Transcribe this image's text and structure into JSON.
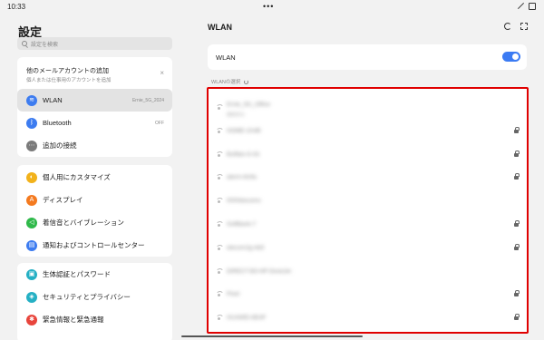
{
  "status": {
    "time": "10:33"
  },
  "sidebar": {
    "title": "設定",
    "search_placeholder": "設定を検索",
    "account": {
      "title": "他のメールアカウントの追加",
      "subtitle": "個人または仕事用のアカウントを追加",
      "close_icon": "close-icon"
    },
    "groups": [
      [
        {
          "label": "WLAN",
          "value": "Ernie_5G_2024",
          "icon": "wifi-icon",
          "color": "#3d7cf0",
          "selected": true
        },
        {
          "label": "Bluetooth",
          "value": "OFF",
          "icon": "bluetooth-icon",
          "color": "#3d7cf0"
        },
        {
          "label": "追加の接続",
          "value": "",
          "icon": "more-connections-icon",
          "color": "#7b7b7b"
        }
      ],
      [
        {
          "label": "個人用にカスタマイズ",
          "icon": "palette-icon",
          "color": "#f2b21b"
        },
        {
          "label": "ディスプレイ",
          "icon": "display-icon",
          "color": "#f47a1f"
        },
        {
          "label": "着信音とバイブレーション",
          "icon": "sound-icon",
          "color": "#2fb94a"
        },
        {
          "label": "通知およびコントロールセンター",
          "icon": "notification-icon",
          "color": "#3d7cf0"
        }
      ],
      [
        {
          "label": "生体認証とパスワード",
          "icon": "lock-icon",
          "color": "#25b0c4"
        },
        {
          "label": "セキュリティとプライバシー",
          "icon": "shield-icon",
          "color": "#25b0c4"
        },
        {
          "label": "緊急情報と緊急通報",
          "icon": "emergency-icon",
          "color": "#e8453c"
        }
      ]
    ]
  },
  "main": {
    "title": "WLAN",
    "refresh_icon": "refresh-icon",
    "scan_icon": "scan-icon",
    "wlan_toggle": {
      "label": "WLAN",
      "on": true
    },
    "available_label": "WLANの選択",
    "networks": [
      {
        "ssid": "Ernie_5G_Office",
        "sub": "接続済み",
        "locked": false
      },
      {
        "ssid": "HOME-2A4B",
        "locked": true
      },
      {
        "ssid": "Buffalo-G-81",
        "locked": true
      },
      {
        "ssid": "aterm-8c9a",
        "locked": true
      },
      {
        "ssid": "0000docomo",
        "locked": false
      },
      {
        "ssid": "SoftBank-7",
        "locked": true
      },
      {
        "ssid": "elecom2g-4d3",
        "locked": true
      },
      {
        "ssid": "DIRECT-B3-HP-DeskJet",
        "locked": false
      },
      {
        "ssid": "Pixel",
        "locked": true
      },
      {
        "ssid": "HUAWEI-8E4F",
        "locked": true
      }
    ]
  }
}
